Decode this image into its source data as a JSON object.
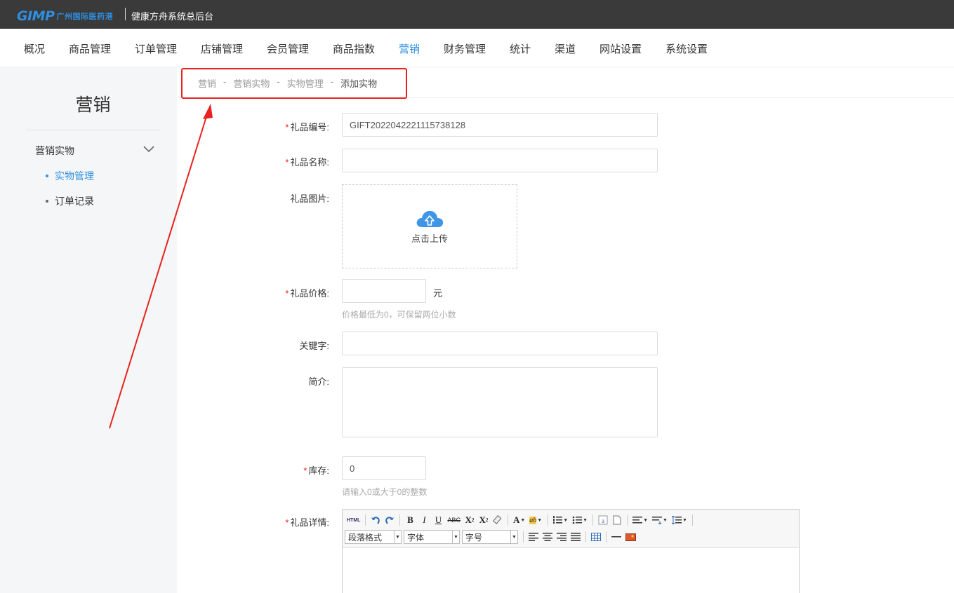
{
  "header": {
    "logo_mark": "GIMP",
    "logo_text": "广州国际医药港",
    "system_title": "健康方舟系统总后台"
  },
  "nav": {
    "items": [
      "概况",
      "商品管理",
      "订单管理",
      "店铺管理",
      "会员管理",
      "商品指数",
      "营销",
      "财务管理",
      "统计",
      "渠道",
      "网站设置",
      "系统设置"
    ],
    "active": "营销"
  },
  "sidebar": {
    "title": "营销",
    "group": "营销实物",
    "items": [
      {
        "label": "实物管理",
        "active": true
      },
      {
        "label": "订单记录",
        "active": false
      }
    ]
  },
  "breadcrumb": [
    "营销",
    "营销实物",
    "实物管理",
    "添加实物"
  ],
  "form": {
    "gift_code": {
      "label": "礼品编号:",
      "required": true,
      "value": "GIFT2022042221115738128"
    },
    "gift_name": {
      "label": "礼品名称:",
      "required": true,
      "value": ""
    },
    "gift_image": {
      "label": "礼品图片:",
      "required": false,
      "upload_text": "点击上传"
    },
    "gift_price": {
      "label": "礼品价格:",
      "required": true,
      "value": "",
      "unit": "元",
      "hint": "价格最低为0，可保留两位小数"
    },
    "keywords": {
      "label": "关键字:",
      "required": false,
      "value": ""
    },
    "intro": {
      "label": "简介:",
      "required": false,
      "value": ""
    },
    "stock": {
      "label": "库存:",
      "required": true,
      "value": "0",
      "hint": "请输入0或大于0的整数"
    },
    "details": {
      "label": "礼品详情:",
      "required": true
    }
  },
  "editor": {
    "html_btn": "HTML",
    "paragraph_select": "段落格式",
    "font_select": "字体",
    "size_select": "字号"
  },
  "colors": {
    "accent": "#2e8fe0",
    "annotation": "#e8231f",
    "topbar": "#3a3a3a"
  }
}
